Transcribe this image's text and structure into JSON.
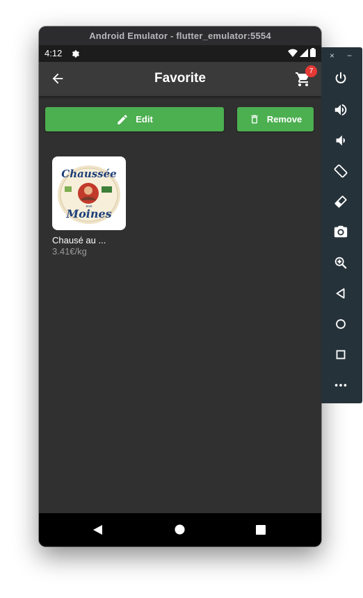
{
  "window": {
    "title": "Android Emulator - flutter_emulator:5554"
  },
  "status_bar": {
    "time": "4:12"
  },
  "app_bar": {
    "title": "Favorite",
    "cart_count": "7"
  },
  "actions": {
    "edit_label": "Edit",
    "remove_label": "Remove"
  },
  "favorites": [
    {
      "name": "Chausé au ...",
      "price": "3.41€/kg",
      "image_text_top": "Chaussée",
      "image_text_mid": "aux",
      "image_text_bottom": "Moines"
    }
  ],
  "toolbar": {
    "close_label": "×",
    "minimize_label": "−",
    "buttons": [
      "power-icon",
      "volume-up-icon",
      "volume-down-icon",
      "rotate-left-icon",
      "rotate-right-icon",
      "camera-icon",
      "zoom-icon",
      "back-icon",
      "home-icon",
      "overview-icon",
      "more-icon"
    ]
  },
  "colors": {
    "accent": "#4caf50",
    "badge": "#e53935",
    "background": "#303030",
    "app_bar": "#3a3a3a"
  }
}
